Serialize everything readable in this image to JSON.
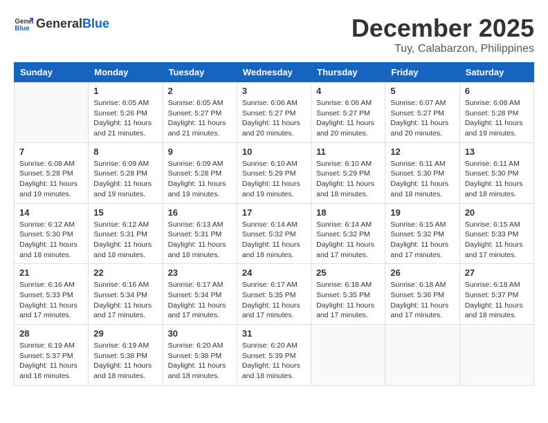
{
  "header": {
    "logo_general": "General",
    "logo_blue": "Blue",
    "month": "December 2025",
    "location": "Tuy, Calabarzon, Philippines"
  },
  "weekdays": [
    "Sunday",
    "Monday",
    "Tuesday",
    "Wednesday",
    "Thursday",
    "Friday",
    "Saturday"
  ],
  "weeks": [
    [
      {
        "day": "",
        "sunrise": "",
        "sunset": "",
        "daylight": ""
      },
      {
        "day": "1",
        "sunrise": "Sunrise: 6:05 AM",
        "sunset": "Sunset: 5:26 PM",
        "daylight": "Daylight: 11 hours and 21 minutes."
      },
      {
        "day": "2",
        "sunrise": "Sunrise: 6:05 AM",
        "sunset": "Sunset: 5:27 PM",
        "daylight": "Daylight: 11 hours and 21 minutes."
      },
      {
        "day": "3",
        "sunrise": "Sunrise: 6:06 AM",
        "sunset": "Sunset: 5:27 PM",
        "daylight": "Daylight: 11 hours and 20 minutes."
      },
      {
        "day": "4",
        "sunrise": "Sunrise: 6:06 AM",
        "sunset": "Sunset: 5:27 PM",
        "daylight": "Daylight: 11 hours and 20 minutes."
      },
      {
        "day": "5",
        "sunrise": "Sunrise: 6:07 AM",
        "sunset": "Sunset: 5:27 PM",
        "daylight": "Daylight: 11 hours and 20 minutes."
      },
      {
        "day": "6",
        "sunrise": "Sunrise: 6:08 AM",
        "sunset": "Sunset: 5:28 PM",
        "daylight": "Daylight: 11 hours and 19 minutes."
      }
    ],
    [
      {
        "day": "7",
        "sunrise": "Sunrise: 6:08 AM",
        "sunset": "Sunset: 5:28 PM",
        "daylight": "Daylight: 11 hours and 19 minutes."
      },
      {
        "day": "8",
        "sunrise": "Sunrise: 6:09 AM",
        "sunset": "Sunset: 5:28 PM",
        "daylight": "Daylight: 11 hours and 19 minutes."
      },
      {
        "day": "9",
        "sunrise": "Sunrise: 6:09 AM",
        "sunset": "Sunset: 5:28 PM",
        "daylight": "Daylight: 11 hours and 19 minutes."
      },
      {
        "day": "10",
        "sunrise": "Sunrise: 6:10 AM",
        "sunset": "Sunset: 5:29 PM",
        "daylight": "Daylight: 11 hours and 19 minutes."
      },
      {
        "day": "11",
        "sunrise": "Sunrise: 6:10 AM",
        "sunset": "Sunset: 5:29 PM",
        "daylight": "Daylight: 11 hours and 18 minutes."
      },
      {
        "day": "12",
        "sunrise": "Sunrise: 6:11 AM",
        "sunset": "Sunset: 5:30 PM",
        "daylight": "Daylight: 11 hours and 18 minutes."
      },
      {
        "day": "13",
        "sunrise": "Sunrise: 6:11 AM",
        "sunset": "Sunset: 5:30 PM",
        "daylight": "Daylight: 11 hours and 18 minutes."
      }
    ],
    [
      {
        "day": "14",
        "sunrise": "Sunrise: 6:12 AM",
        "sunset": "Sunset: 5:30 PM",
        "daylight": "Daylight: 11 hours and 18 minutes."
      },
      {
        "day": "15",
        "sunrise": "Sunrise: 6:12 AM",
        "sunset": "Sunset: 5:31 PM",
        "daylight": "Daylight: 11 hours and 18 minutes."
      },
      {
        "day": "16",
        "sunrise": "Sunrise: 6:13 AM",
        "sunset": "Sunset: 5:31 PM",
        "daylight": "Daylight: 11 hours and 18 minutes."
      },
      {
        "day": "17",
        "sunrise": "Sunrise: 6:14 AM",
        "sunset": "Sunset: 5:32 PM",
        "daylight": "Daylight: 11 hours and 18 minutes."
      },
      {
        "day": "18",
        "sunrise": "Sunrise: 6:14 AM",
        "sunset": "Sunset: 5:32 PM",
        "daylight": "Daylight: 11 hours and 17 minutes."
      },
      {
        "day": "19",
        "sunrise": "Sunrise: 6:15 AM",
        "sunset": "Sunset: 5:32 PM",
        "daylight": "Daylight: 11 hours and 17 minutes."
      },
      {
        "day": "20",
        "sunrise": "Sunrise: 6:15 AM",
        "sunset": "Sunset: 5:33 PM",
        "daylight": "Daylight: 11 hours and 17 minutes."
      }
    ],
    [
      {
        "day": "21",
        "sunrise": "Sunrise: 6:16 AM",
        "sunset": "Sunset: 5:33 PM",
        "daylight": "Daylight: 11 hours and 17 minutes."
      },
      {
        "day": "22",
        "sunrise": "Sunrise: 6:16 AM",
        "sunset": "Sunset: 5:34 PM",
        "daylight": "Daylight: 11 hours and 17 minutes."
      },
      {
        "day": "23",
        "sunrise": "Sunrise: 6:17 AM",
        "sunset": "Sunset: 5:34 PM",
        "daylight": "Daylight: 11 hours and 17 minutes."
      },
      {
        "day": "24",
        "sunrise": "Sunrise: 6:17 AM",
        "sunset": "Sunset: 5:35 PM",
        "daylight": "Daylight: 11 hours and 17 minutes."
      },
      {
        "day": "25",
        "sunrise": "Sunrise: 6:18 AM",
        "sunset": "Sunset: 5:35 PM",
        "daylight": "Daylight: 11 hours and 17 minutes."
      },
      {
        "day": "26",
        "sunrise": "Sunrise: 6:18 AM",
        "sunset": "Sunset: 5:36 PM",
        "daylight": "Daylight: 11 hours and 17 minutes."
      },
      {
        "day": "27",
        "sunrise": "Sunrise: 6:18 AM",
        "sunset": "Sunset: 5:37 PM",
        "daylight": "Daylight: 11 hours and 18 minutes."
      }
    ],
    [
      {
        "day": "28",
        "sunrise": "Sunrise: 6:19 AM",
        "sunset": "Sunset: 5:37 PM",
        "daylight": "Daylight: 11 hours and 18 minutes."
      },
      {
        "day": "29",
        "sunrise": "Sunrise: 6:19 AM",
        "sunset": "Sunset: 5:38 PM",
        "daylight": "Daylight: 11 hours and 18 minutes."
      },
      {
        "day": "30",
        "sunrise": "Sunrise: 6:20 AM",
        "sunset": "Sunset: 5:38 PM",
        "daylight": "Daylight: 11 hours and 18 minutes."
      },
      {
        "day": "31",
        "sunrise": "Sunrise: 6:20 AM",
        "sunset": "Sunset: 5:39 PM",
        "daylight": "Daylight: 11 hours and 18 minutes."
      },
      {
        "day": "",
        "sunrise": "",
        "sunset": "",
        "daylight": ""
      },
      {
        "day": "",
        "sunrise": "",
        "sunset": "",
        "daylight": ""
      },
      {
        "day": "",
        "sunrise": "",
        "sunset": "",
        "daylight": ""
      }
    ]
  ]
}
